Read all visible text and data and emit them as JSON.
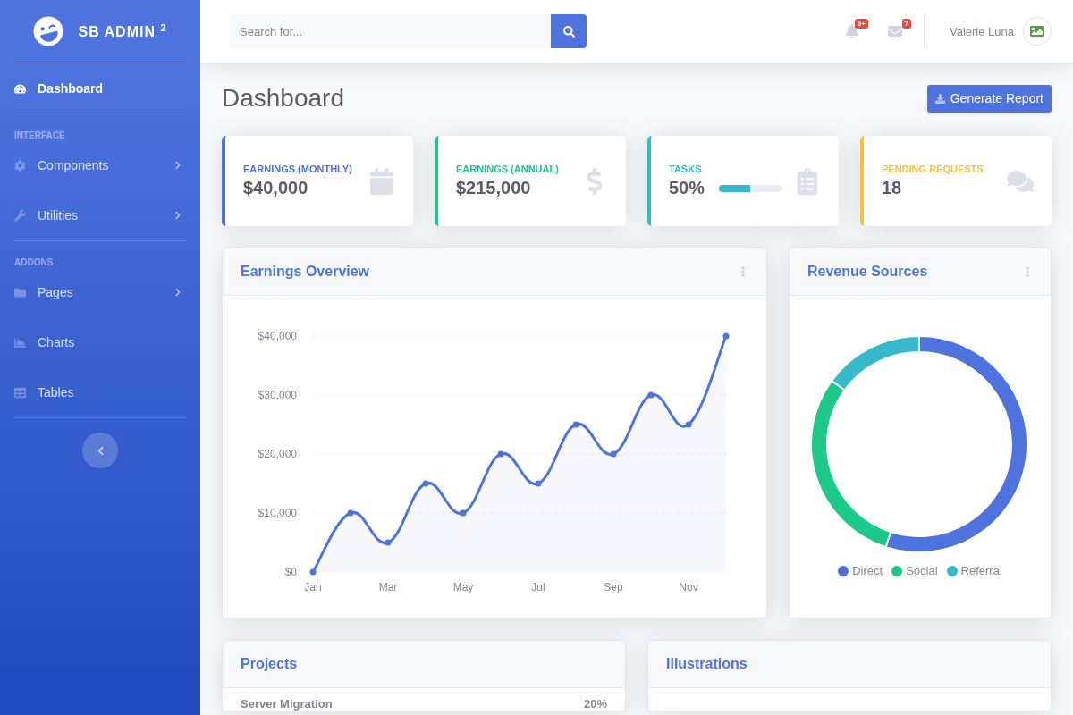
{
  "sidebar": {
    "brand": "SB ADMIN $^{2}$",
    "sections": [
      {
        "items": [
          {
            "label": "Dashboard",
            "selected": true,
            "submenu": false
          }
        ]
      },
      {
        "heading": "INTERFACE",
        "items": [
          {
            "label": "Components",
            "selected": false,
            "submenu": true
          },
          {
            "label": "Utilities",
            "selected": false,
            "submenu": true
          }
        ]
      },
      {
        "heading": "ADDONS",
        "items": [
          {
            "label": "Pages",
            "selected": false,
            "submenu": true
          },
          {
            "label": "Charts",
            "selected": false,
            "submenu": false
          },
          {
            "label": "Tables",
            "selected": false,
            "submenu": false
          }
        ]
      }
    ]
  },
  "topbar": {
    "search": {
      "placeholder": "Search for..."
    },
    "alerts": [
      {
        "badge": "3+"
      },
      {
        "badge": "7"
      }
    ],
    "user": {
      "name": "Valerie Luna"
    }
  },
  "page": {
    "title": "Dashboard",
    "button": "Generate Report"
  },
  "stats": [
    {
      "kind": "text",
      "label": "EARNINGS (MONTHLY)",
      "value": "$40,000",
      "color": "#4e73df"
    },
    {
      "kind": "text",
      "label": "EARNINGS (ANNUAL)",
      "value": "$215,000",
      "color": "#1cc88a"
    },
    {
      "kind": "progress",
      "label": "TASKS",
      "value": "50%",
      "level": 0.5,
      "color": "#36b9cc"
    },
    {
      "kind": "text",
      "label": "PENDING REQUESTS",
      "value": "18",
      "color": "#f6c23e"
    }
  ],
  "earnings": {
    "title": "Earnings Overview",
    "chart_data": {
      "type": "area",
      "categories": [
        "Jan",
        null,
        "Mar",
        null,
        "May",
        null,
        "Jul",
        null,
        "Sep",
        null,
        "Nov",
        null
      ],
      "grid": true,
      "series": [
        {
          "color": "#4e73df",
          "values": [
            0,
            10000,
            5000,
            15000,
            10000,
            20000,
            15000,
            25000,
            20000,
            30000,
            25000,
            40000
          ]
        }
      ],
      "ylim": [
        0,
        40000
      ],
      "yticks": [
        {
          "value": 0,
          "label": "$0"
        },
        {
          "value": 10000,
          "label": "$10,000"
        },
        {
          "value": 20000,
          "label": "$20,000"
        },
        {
          "value": 30000,
          "label": "$30,000"
        },
        {
          "value": 40000,
          "label": "$40,000"
        }
      ]
    }
  },
  "revenue": {
    "title": "Revenue Sources",
    "chart_data": {
      "type": "donut",
      "categories": [
        "Direct",
        "Social",
        "Referral"
      ],
      "values": [
        55,
        30,
        15
      ]
    },
    "legend": [
      {
        "color": "#4e73df"
      },
      {
        "color": "#1cc88a"
      },
      {
        "color": "#36b9cc"
      }
    ]
  },
  "projects": {
    "title": "Projects",
    "rows": [
      {
        "name": "Server Migration",
        "percent": "20%"
      }
    ]
  },
  "illustrations": {
    "title": "Illustrations"
  }
}
